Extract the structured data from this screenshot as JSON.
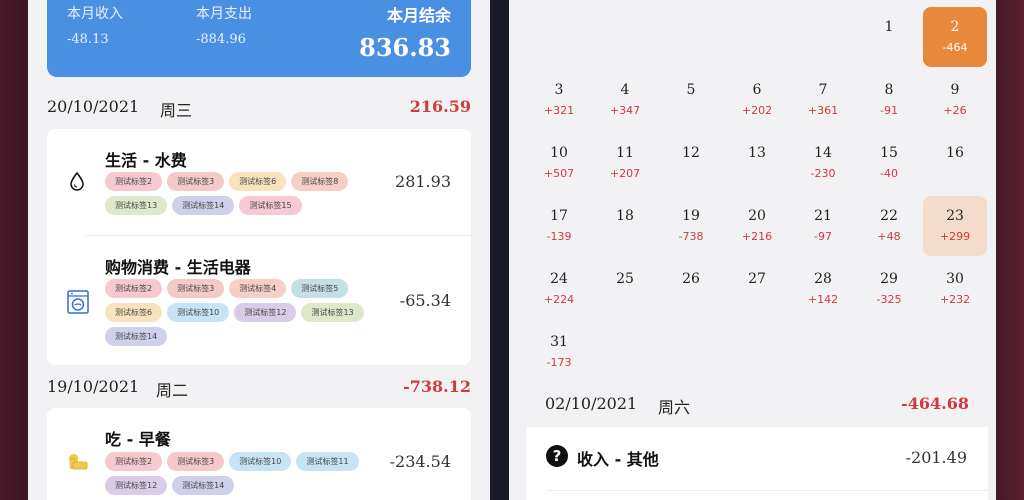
{
  "summary": {
    "income_label": "本月收入",
    "income_value": "-48.13",
    "expense_label": "本月支出",
    "expense_value": "-884.96",
    "balance_label": "本月结余",
    "balance_value": "836.83",
    "accent_color": "#4a90e2"
  },
  "days": [
    {
      "date": "20/10/2021",
      "weekday": "周三",
      "total": "216.59",
      "transactions": [
        {
          "title": "生活 - 水费",
          "amount": "281.93",
          "icon": "water-drop-icon",
          "tags": [
            "测试标签2",
            "测试标签3",
            "测试标签6",
            "测试标签8",
            "测试标签13",
            "测试标签14",
            "测试标签15"
          ]
        },
        {
          "title": "购物消费 - 生活电器",
          "amount": "-65.34",
          "icon": "washing-machine-icon",
          "tags": [
            "测试标签2",
            "测试标签3",
            "测试标签4",
            "测试标签5",
            "测试标签6",
            "测试标签10",
            "测试标签12",
            "测试标签13",
            "测试标签14"
          ]
        }
      ]
    },
    {
      "date": "19/10/2021",
      "weekday": "周二",
      "total": "-738.12",
      "transactions": [
        {
          "title": "吃 - 早餐",
          "amount": "-234.54",
          "icon": "bread-icon",
          "tags": [
            "测试标签2",
            "测试标签3",
            "测试标签10",
            "测试标签11",
            "测试标签12",
            "测试标签14"
          ]
        }
      ]
    }
  ],
  "calendar": {
    "cells": [
      {
        "day": "1",
        "delta": ""
      },
      {
        "day": "2",
        "delta": "-464",
        "state": "selected"
      },
      {
        "day": "3",
        "delta": "+321"
      },
      {
        "day": "4",
        "delta": "+347"
      },
      {
        "day": "5",
        "delta": ""
      },
      {
        "day": "6",
        "delta": "+202"
      },
      {
        "day": "7",
        "delta": "+361"
      },
      {
        "day": "8",
        "delta": "-91"
      },
      {
        "day": "9",
        "delta": "+26"
      },
      {
        "day": "10",
        "delta": "+507"
      },
      {
        "day": "11",
        "delta": "+207"
      },
      {
        "day": "12",
        "delta": ""
      },
      {
        "day": "13",
        "delta": ""
      },
      {
        "day": "14",
        "delta": "-230"
      },
      {
        "day": "15",
        "delta": "-40"
      },
      {
        "day": "16",
        "delta": ""
      },
      {
        "day": "17",
        "delta": "-139"
      },
      {
        "day": "18",
        "delta": ""
      },
      {
        "day": "19",
        "delta": "-738"
      },
      {
        "day": "20",
        "delta": "+216"
      },
      {
        "day": "21",
        "delta": "-97"
      },
      {
        "day": "22",
        "delta": "+48"
      },
      {
        "day": "23",
        "delta": "+299",
        "state": "today"
      },
      {
        "day": "24",
        "delta": "+224"
      },
      {
        "day": "25",
        "delta": ""
      },
      {
        "day": "26",
        "delta": ""
      },
      {
        "day": "27",
        "delta": ""
      },
      {
        "day": "28",
        "delta": "+142"
      },
      {
        "day": "29",
        "delta": "-325"
      },
      {
        "day": "30",
        "delta": "+232"
      },
      {
        "day": "31",
        "delta": "-173"
      }
    ],
    "selected_color": "#e8883a",
    "today_color": "#f3dccb"
  },
  "selected_day": {
    "date": "02/10/2021",
    "weekday": "周六",
    "total": "-464.68",
    "transaction": {
      "title": "收入 - 其他",
      "amount": "-201.49",
      "icon": "question-circle-icon",
      "icon_glyph": "?"
    }
  }
}
